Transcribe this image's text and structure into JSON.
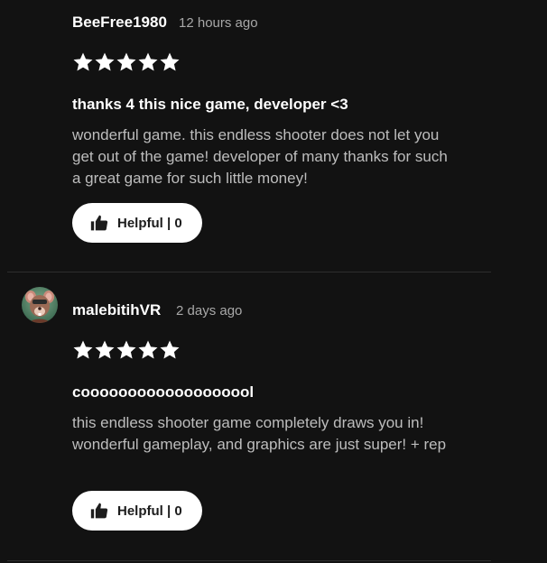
{
  "reviews": [
    {
      "author": "BeeFree1980",
      "time": "12 hours ago",
      "rating": 5,
      "title": "thanks 4 this nice game, developer <3",
      "body": "wonderful game. this endless shooter does not let you get out of the game! developer of many thanks for such a great game for such little money!",
      "helpful_label": "Helpful | 0",
      "has_avatar": false
    },
    {
      "author": "malebitihVR",
      "time": "2 days ago",
      "rating": 5,
      "title": "cooooooooooooooooool",
      "body": "this endless shooter game completely draws you in! wonderful gameplay, and graphics are just super! + rep",
      "helpful_label": "Helpful | 0",
      "has_avatar": true
    }
  ],
  "colors": {
    "background": "#121212",
    "star": "#ffffff",
    "secondary_text": "#a8a8a8",
    "body_text": "#bdbdbd",
    "button_bg": "#ffffff"
  },
  "icons": {
    "star": "star-icon",
    "thumbs_up": "thumbs-up-icon",
    "avatar": "cartoon-rat-avatar"
  }
}
